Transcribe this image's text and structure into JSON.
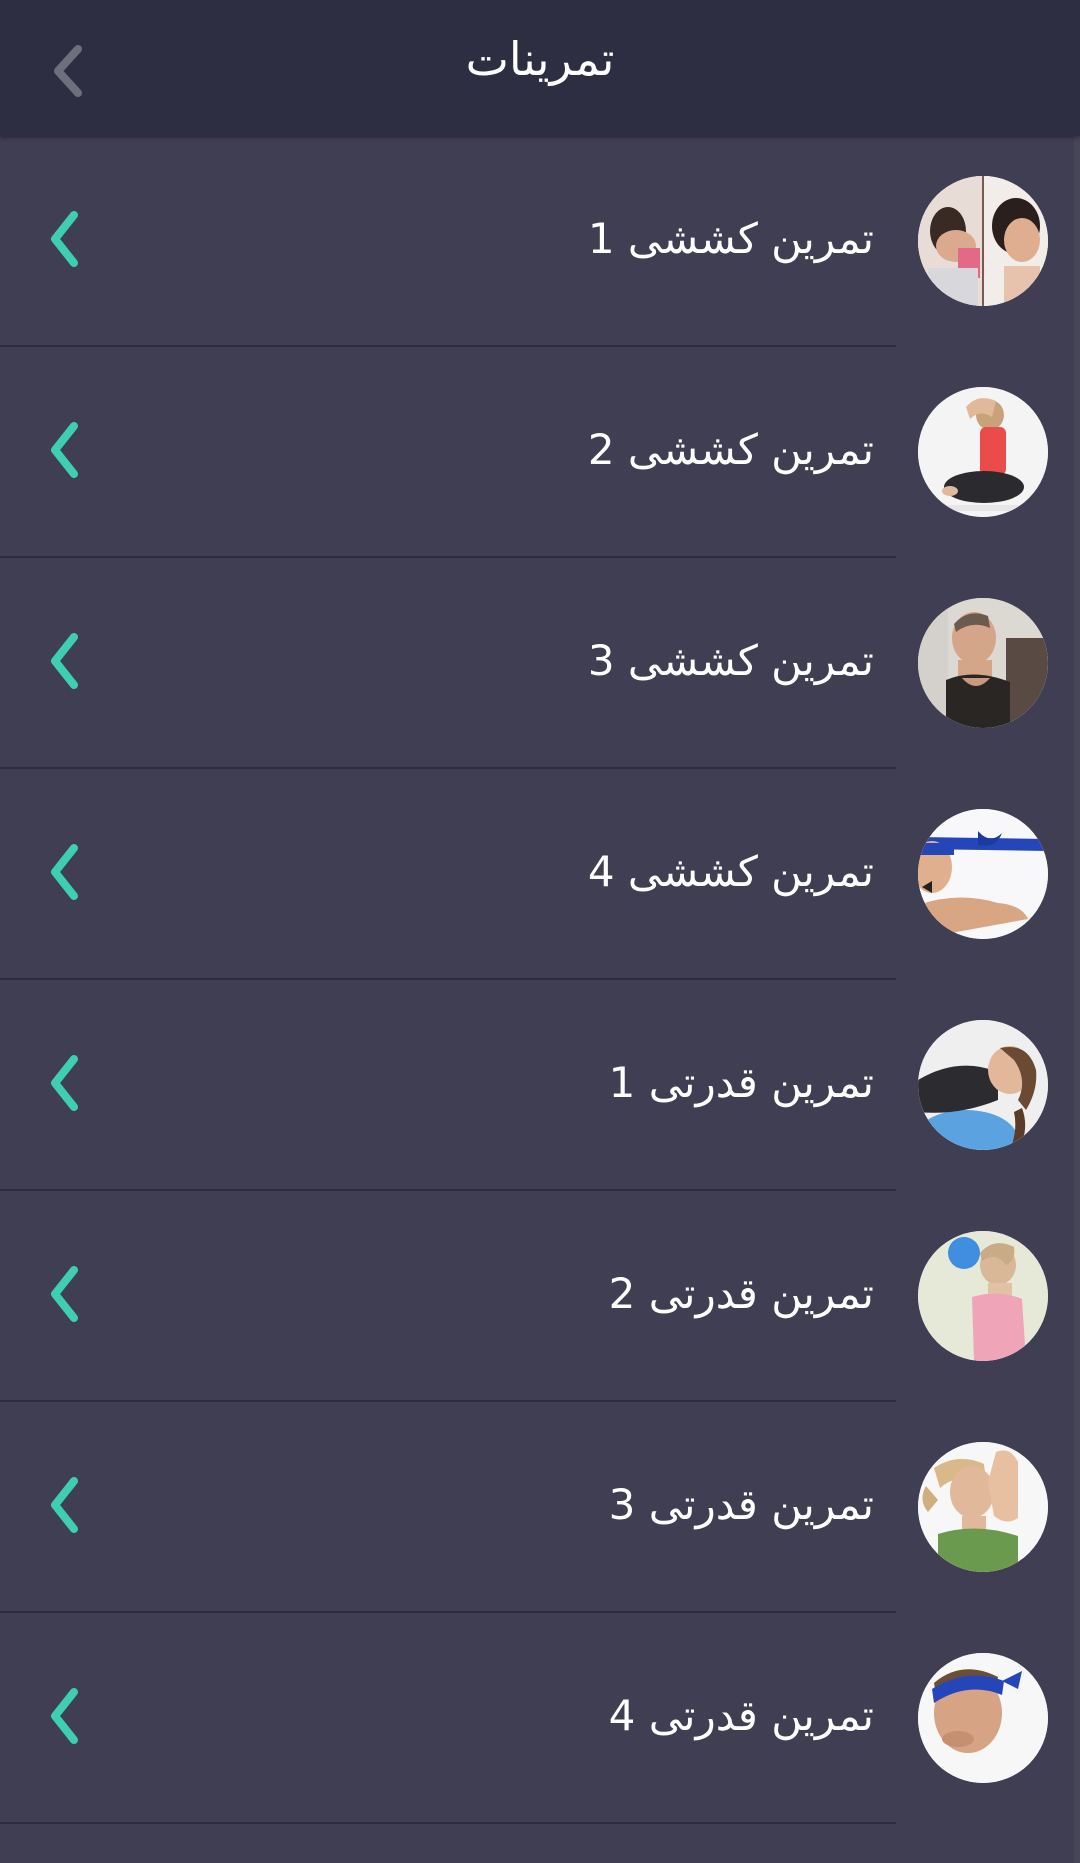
{
  "header": {
    "title": "تمرینات",
    "back_icon": "chevron-left-icon"
  },
  "colors": {
    "background": "#403e52",
    "header": "#2d2e42",
    "accent": "#3ecfb0",
    "divider": "#2e2d3d"
  },
  "list": {
    "items": [
      {
        "label": "تمرین کششی 1",
        "thumbnail": "neck-stretch-photo"
      },
      {
        "label": "تمرین کششی 2",
        "thumbnail": "seated-woman-photo"
      },
      {
        "label": "تمرین کششی 3",
        "thumbnail": "man-wall-photo"
      },
      {
        "label": "تمرین کششی 4",
        "thumbnail": "resistance-band-photo"
      },
      {
        "label": "تمرین قدرتی 1",
        "thumbnail": "ball-neck-photo"
      },
      {
        "label": "تمرین قدرتی 2",
        "thumbnail": "wall-ball-photo"
      },
      {
        "label": "تمرین قدرتی 3",
        "thumbnail": "hand-press-photo"
      },
      {
        "label": "تمرین قدرتی 4",
        "thumbnail": "headband-man-photo"
      }
    ]
  }
}
